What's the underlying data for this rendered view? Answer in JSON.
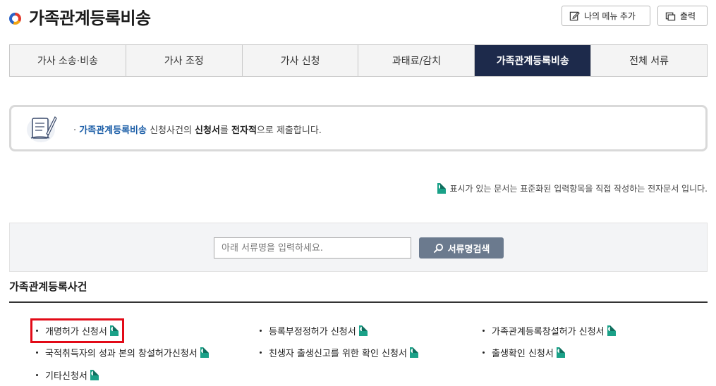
{
  "header": {
    "title": "가족관계등록비송",
    "my_menu_label": "나의 메뉴 추가",
    "print_label": "출력"
  },
  "tabs": [
    {
      "label": "가사 소송·비송",
      "active": false
    },
    {
      "label": "가사 조정",
      "active": false
    },
    {
      "label": "가사 신청",
      "active": false
    },
    {
      "label": "과태료/감치",
      "active": false
    },
    {
      "label": "가족관계등록비송",
      "active": true
    },
    {
      "label": "전체 서류",
      "active": false
    }
  ],
  "info": {
    "bullet": "·",
    "highlight": "가족관계등록비송",
    "part1": " 신청사건의 ",
    "bold1": "신청서",
    "part2": "를 ",
    "bold2": "전자적",
    "part3": "으로 제출합니다."
  },
  "legend": {
    "text": "표시가 있는 문서는 표준화된 입력항목을 직접 작성하는 전자문서 입니다."
  },
  "search": {
    "placeholder": "아래 서류명을 입력하세요.",
    "value": "",
    "button_label": "서류명검색"
  },
  "section": {
    "title": "가족관계등록사건",
    "items": [
      {
        "label": "개명허가 신청서",
        "e_doc": true,
        "selected": true
      },
      {
        "label": "등록부정정허가 신청서",
        "e_doc": true,
        "selected": false
      },
      {
        "label": "가족관계등록창설허가 신청서",
        "e_doc": true,
        "selected": false
      },
      {
        "label": "국적취득자의 성과 본의 창설허가신청서",
        "e_doc": true,
        "selected": false
      },
      {
        "label": "친생자 출생신고를 위한 확인 신청서",
        "e_doc": true,
        "selected": false
      },
      {
        "label": "출생확인 신청서",
        "e_doc": true,
        "selected": false
      },
      {
        "label": "기타신청서",
        "e_doc": true,
        "selected": false
      }
    ]
  },
  "colors": {
    "active_tab": "#1d2a4b",
    "highlight": "#1d5fa8",
    "e_doc_icon": "#1aa188",
    "selection_outline": "#e20a17",
    "search_button": "#6b7a8e"
  },
  "icons": {
    "title_mark": "circle-logo-icon",
    "my_menu": "edit-icon",
    "print": "print-icon",
    "info": "document-quill-icon",
    "e_doc": "e-document-icon",
    "search": "search-icon"
  }
}
